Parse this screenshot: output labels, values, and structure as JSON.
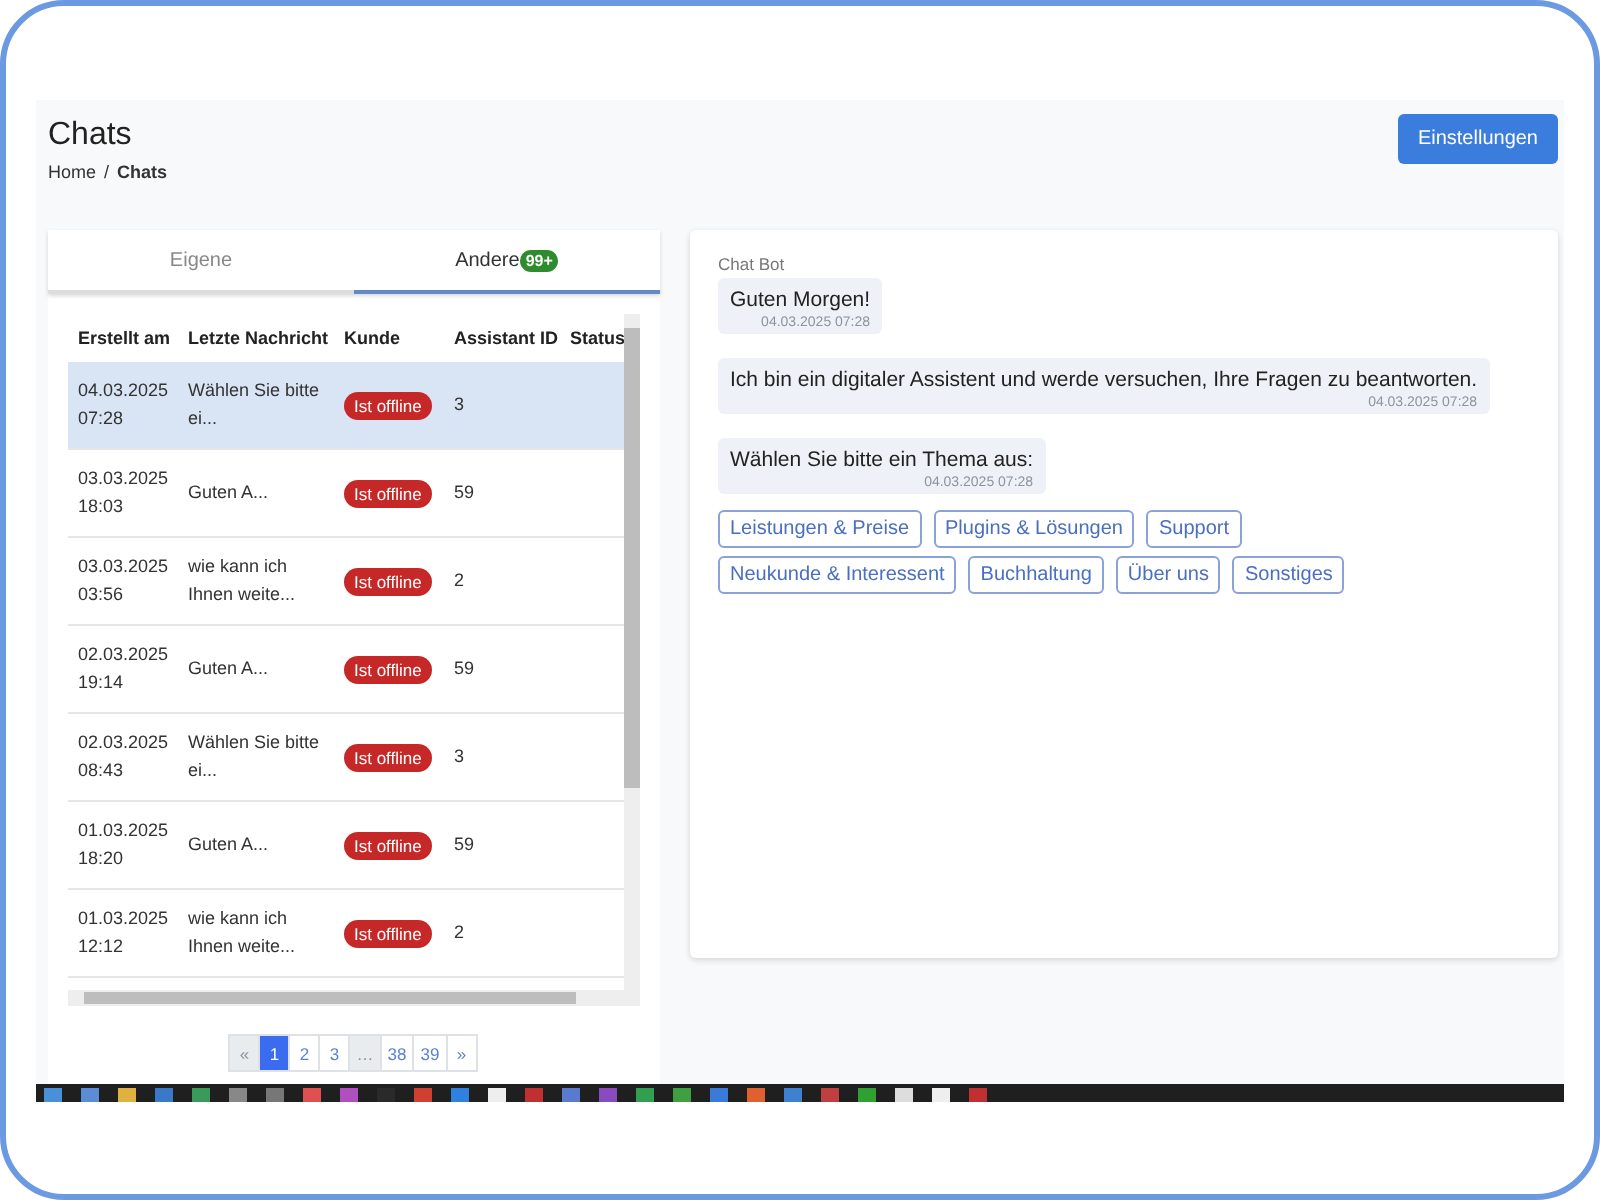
{
  "page": {
    "title": "Chats",
    "breadcrumb_separator": "/",
    "breadcrumb": [
      {
        "label": "Home",
        "current": false
      },
      {
        "label": "Chats",
        "current": true
      }
    ],
    "settings_button": "Einstellungen"
  },
  "tabs": [
    {
      "label": "Eigene",
      "selected": false
    },
    {
      "label": "Andere",
      "badge": "99+",
      "selected": true
    }
  ],
  "table": {
    "columns": [
      "Erstellt am",
      "Letzte Nachricht",
      "Kunde",
      "Assistant ID",
      "Status"
    ],
    "rows": [
      {
        "created": "04.03.2025\n07:28",
        "message": "Wählen Sie bitte ei...",
        "customer": "Ist offline",
        "assistant_id": "3",
        "selected": true
      },
      {
        "created": "03.03.2025\n18:03",
        "message": "Guten A...",
        "customer": "Ist offline",
        "assistant_id": "59",
        "selected": false
      },
      {
        "created": "03.03.2025\n03:56",
        "message": "wie kann ich Ihnen weite...",
        "customer": "Ist offline",
        "assistant_id": "2",
        "selected": false
      },
      {
        "created": "02.03.2025\n19:14",
        "message": "Guten A...",
        "customer": "Ist offline",
        "assistant_id": "59",
        "selected": false
      },
      {
        "created": "02.03.2025\n08:43",
        "message": "Wählen Sie bitte ei...",
        "customer": "Ist offline",
        "assistant_id": "3",
        "selected": false
      },
      {
        "created": "01.03.2025\n18:20",
        "message": "Guten A...",
        "customer": "Ist offline",
        "assistant_id": "59",
        "selected": false
      },
      {
        "created": "01.03.2025\n12:12",
        "message": "wie kann ich Ihnen weite...",
        "customer": "Ist offline",
        "assistant_id": "2",
        "selected": false
      }
    ]
  },
  "pagination": [
    {
      "label": "«",
      "selected": false,
      "disabled": true
    },
    {
      "label": "1",
      "selected": true,
      "disabled": false
    },
    {
      "label": "2",
      "selected": false,
      "disabled": false
    },
    {
      "label": "3",
      "selected": false,
      "disabled": false
    },
    {
      "label": "…",
      "selected": false,
      "disabled": true
    },
    {
      "label": "38",
      "selected": false,
      "disabled": false
    },
    {
      "label": "39",
      "selected": false,
      "disabled": false
    },
    {
      "label": "»",
      "selected": false,
      "disabled": false
    }
  ],
  "chat": {
    "sender": "Chat Bot",
    "messages": [
      {
        "text": "Guten Morgen!",
        "time": "04.03.2025 07:28"
      },
      {
        "text": "Ich bin ein digitaler Assistent und werde versuchen, Ihre Fragen zu beantworten.",
        "time": "04.03.2025 07:28"
      },
      {
        "text": "Wählen Sie bitte ein Thema aus:",
        "time": "04.03.2025 07:28"
      }
    ],
    "options": [
      [
        "Leistungen & Preise",
        "Plugins & Lösungen",
        "Support"
      ],
      [
        "Neukunde & Interessent",
        "Buchhaltung",
        "Über uns",
        "Sonstiges"
      ]
    ]
  }
}
